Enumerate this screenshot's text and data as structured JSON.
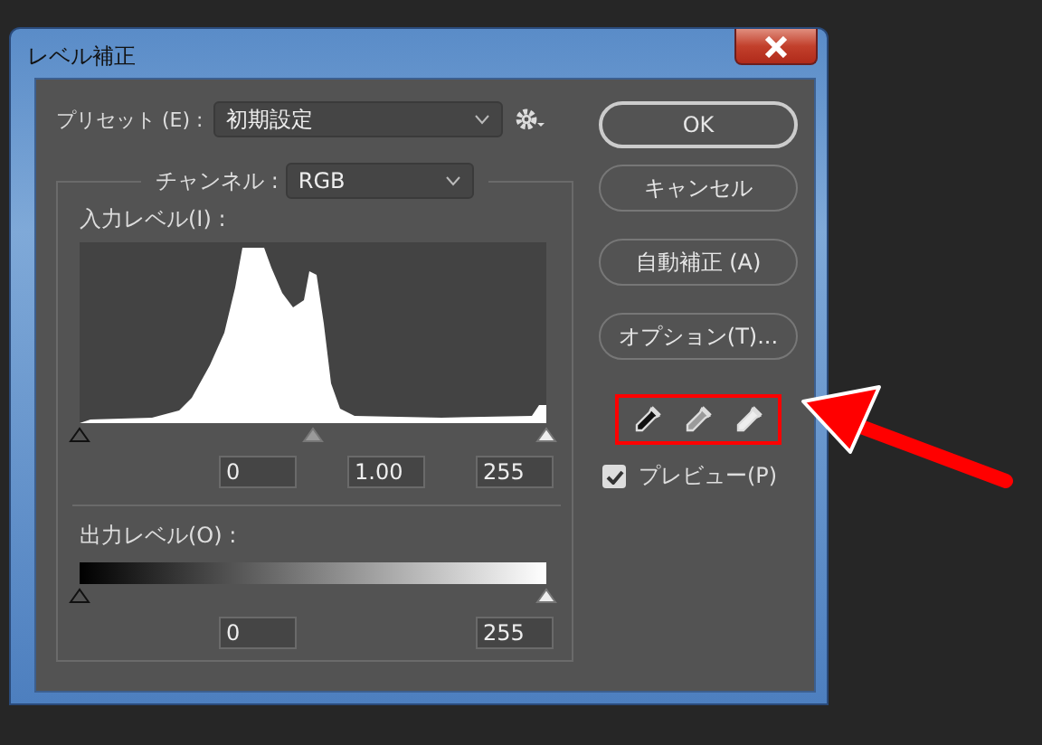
{
  "window": {
    "title": "レベル補正"
  },
  "preset": {
    "label": "プリセット (E) :",
    "value": "初期設定"
  },
  "channel": {
    "label": "チャンネル :",
    "value": "RGB"
  },
  "input_levels": {
    "label": "入力レベル(I) :",
    "handles": [
      {
        "kind": "black",
        "level": 0
      },
      {
        "kind": "gray",
        "level": 0.5
      },
      {
        "kind": "white",
        "level": 1
      }
    ],
    "fields": [
      "0",
      "1.00",
      "255"
    ]
  },
  "output_levels": {
    "label": "出力レベル(O) :",
    "handles": [
      {
        "kind": "black",
        "level": 0
      },
      {
        "kind": "white",
        "level": 1
      }
    ],
    "fields": [
      "0",
      "255"
    ]
  },
  "buttons": [
    {
      "label": "OK",
      "default": true
    },
    {
      "label": "キャンセル",
      "default": false
    },
    {
      "label": "自動補正 (A)",
      "default": false
    },
    {
      "label": "オプション(T)...",
      "default": false
    }
  ],
  "eyedroppers": [
    {
      "kind": "black"
    },
    {
      "kind": "gray"
    },
    {
      "kind": "white"
    }
  ],
  "preview": {
    "label": "プレビュー(P)",
    "checked": true
  },
  "annotations": {
    "highlight_box": true,
    "arrow": true
  }
}
